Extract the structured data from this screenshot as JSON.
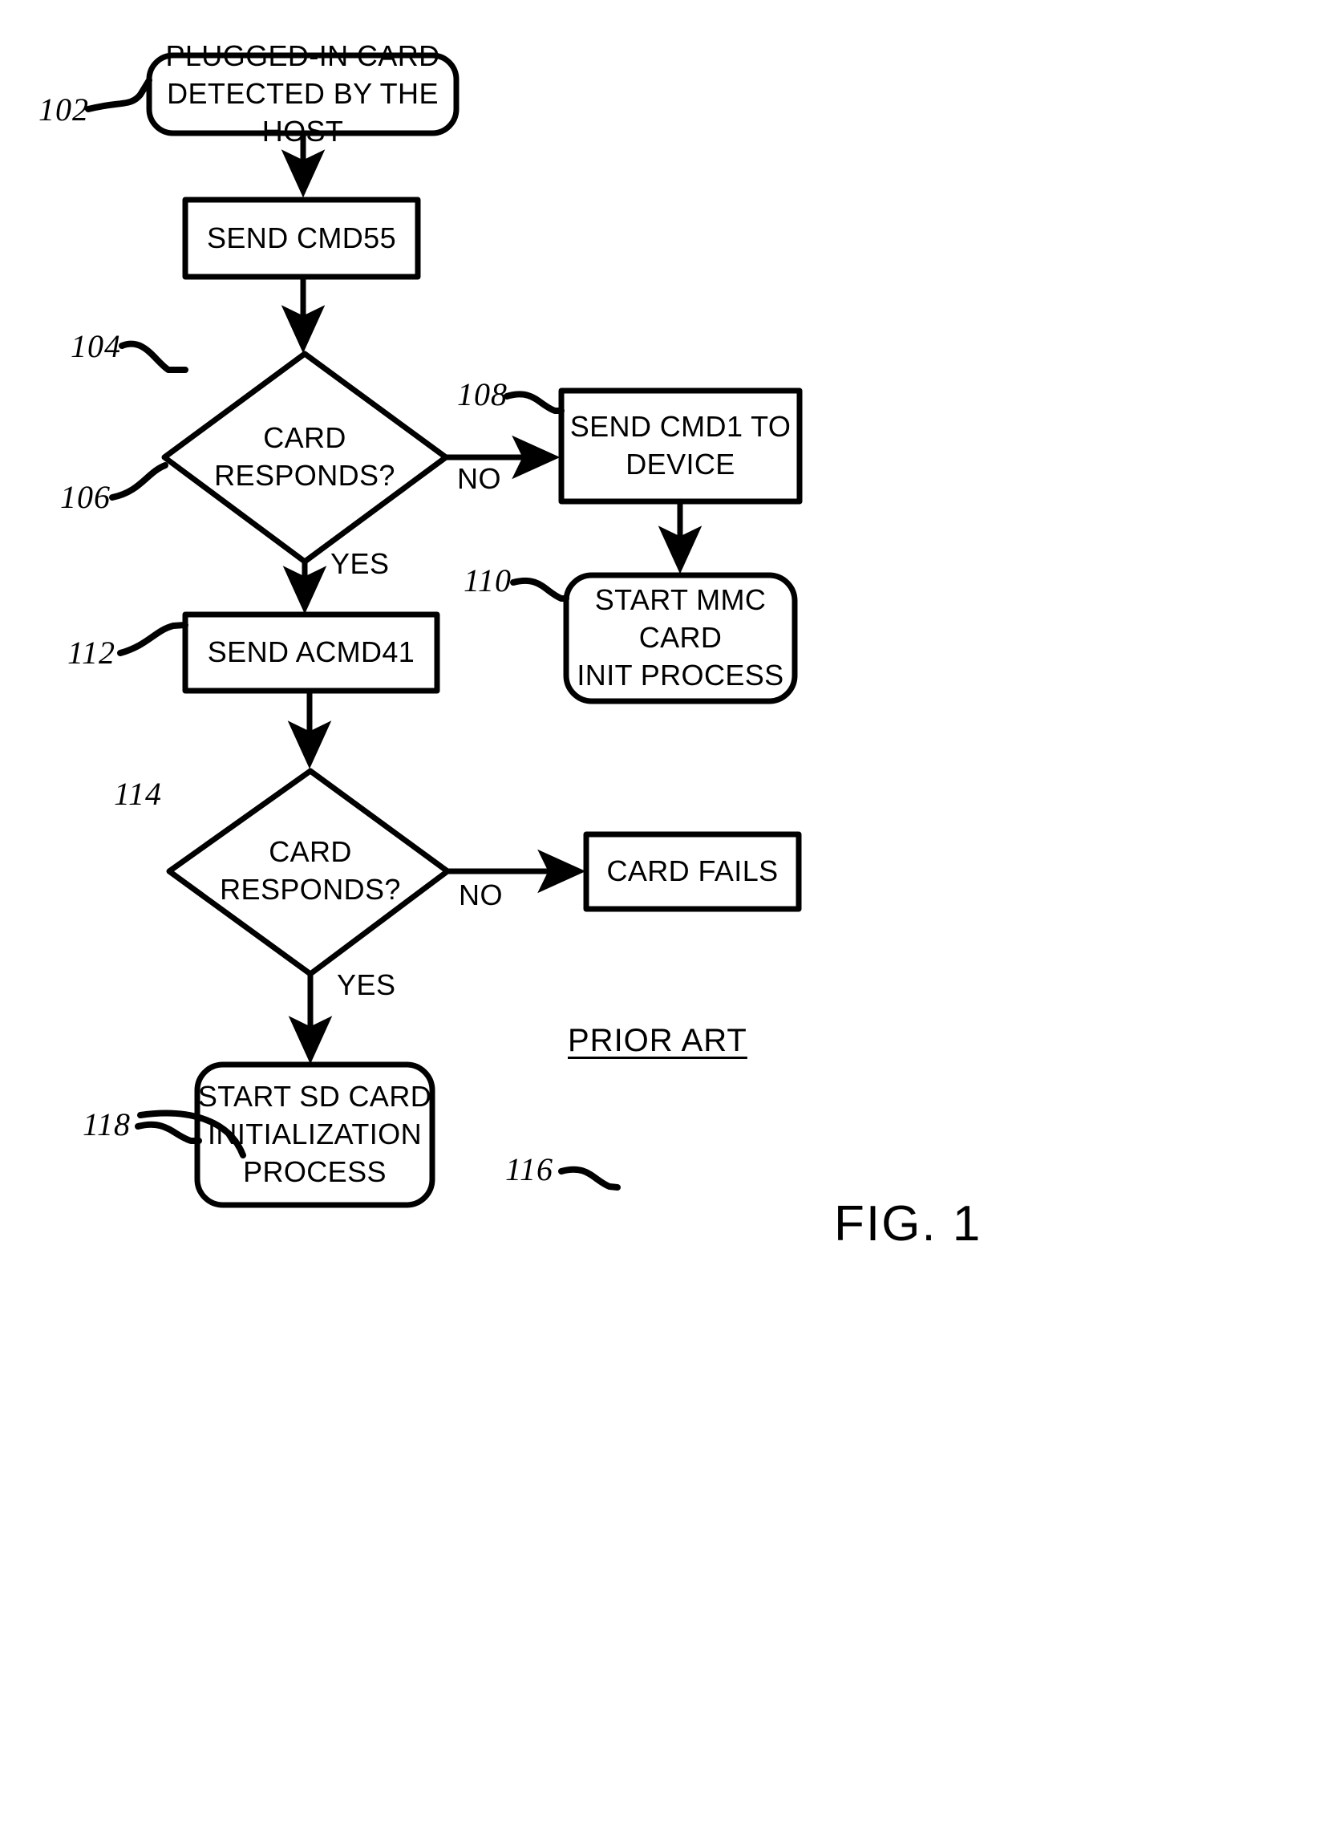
{
  "figure": {
    "caption": "FIG. 1",
    "prior_art_note": "PRIOR ART",
    "type": "flowchart"
  },
  "nodes": [
    {
      "ref": "102",
      "shape": "rounded-rectangle",
      "text": "PLUGGED-IN CARD\nDETECTED BY THE HOST"
    },
    {
      "ref": "104",
      "shape": "rectangle",
      "text": "SEND CMD55"
    },
    {
      "ref": "106",
      "shape": "diamond",
      "text": "CARD\nRESPONDS?"
    },
    {
      "ref": "108",
      "shape": "rectangle",
      "text": "SEND CMD1 TO\nDEVICE"
    },
    {
      "ref": "110",
      "shape": "rounded-rectangle",
      "text": "START MMC CARD\nINIT PROCESS"
    },
    {
      "ref": "112",
      "shape": "rectangle",
      "text": "SEND ACMD41"
    },
    {
      "ref": "114",
      "shape": "diamond",
      "text": "CARD\nRESPONDS?"
    },
    {
      "ref": "116",
      "shape": "rectangle",
      "text": "CARD FAILS"
    },
    {
      "ref": "118",
      "shape": "rounded-rectangle",
      "text": "START SD CARD\nINITIALIZATION\nPROCESS"
    }
  ],
  "edge_labels": {
    "decision_106_no": "NO",
    "decision_106_yes": "YES",
    "decision_114_no": "NO",
    "decision_114_yes": "YES"
  },
  "style": {
    "ink": "#000000",
    "paper": "#ffffff"
  }
}
